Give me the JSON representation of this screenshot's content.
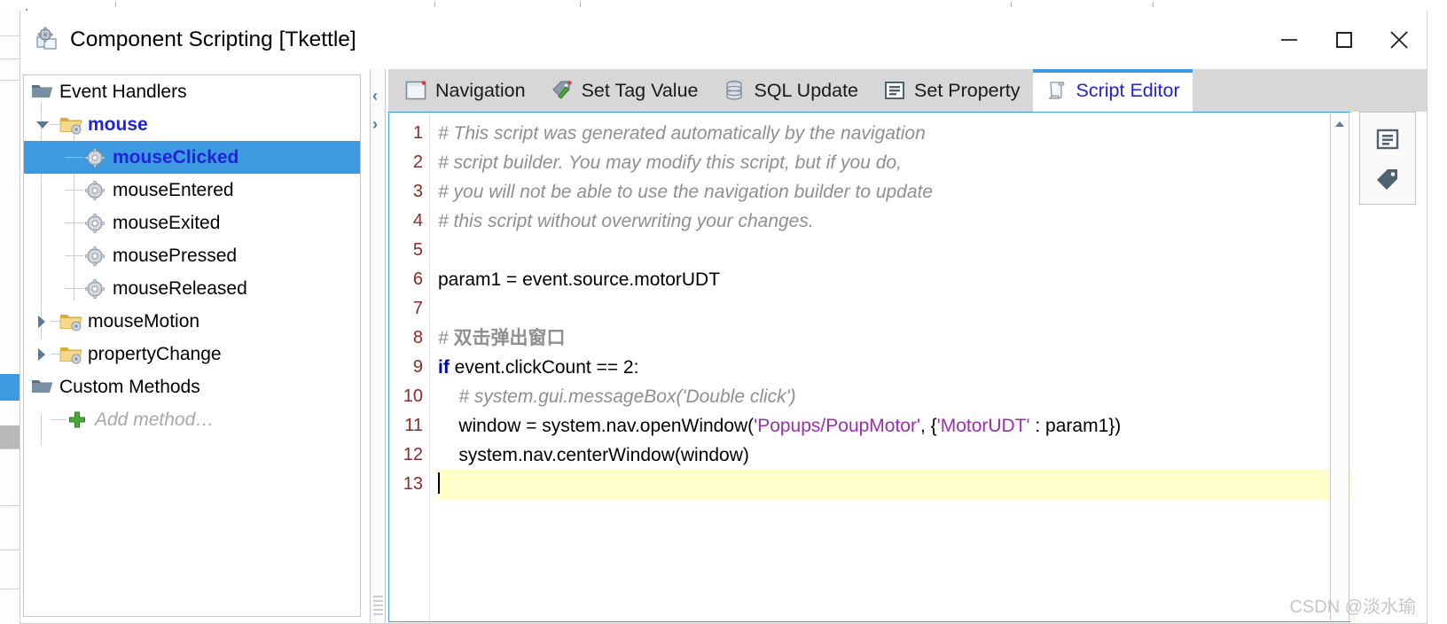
{
  "window": {
    "title": "Component Scripting [Tkettle]",
    "icon": "component-scripting-icon",
    "buttons": {
      "minimize": "minimize-button",
      "maximize": "maximize-button",
      "close": "close-button"
    }
  },
  "tree": {
    "items": [
      {
        "label": "Event Handlers",
        "icon": "folder-dark-icon",
        "indent": 0,
        "twisty": "none",
        "state": "normal",
        "connector": "none"
      },
      {
        "label": "mouse",
        "icon": "folder-gear-icon",
        "indent": 1,
        "twisty": "down",
        "state": "bold",
        "connector": "dash"
      },
      {
        "label": "mouseClicked",
        "icon": "gear-icon",
        "indent": 2,
        "twisty": "none",
        "state": "selected",
        "connector": "tee"
      },
      {
        "label": "mouseEntered",
        "icon": "gear-icon",
        "indent": 2,
        "twisty": "none",
        "state": "normal",
        "connector": "tee"
      },
      {
        "label": "mouseExited",
        "icon": "gear-icon",
        "indent": 2,
        "twisty": "none",
        "state": "normal",
        "connector": "tee"
      },
      {
        "label": "mousePressed",
        "icon": "gear-icon",
        "indent": 2,
        "twisty": "none",
        "state": "normal",
        "connector": "tee"
      },
      {
        "label": "mouseReleased",
        "icon": "gear-icon",
        "indent": 2,
        "twisty": "none",
        "state": "normal",
        "connector": "elbow"
      },
      {
        "label": "mouseMotion",
        "icon": "folder-gear-icon",
        "indent": 1,
        "twisty": "right",
        "state": "normal",
        "connector": "dash"
      },
      {
        "label": "propertyChange",
        "icon": "folder-gear-icon",
        "indent": 1,
        "twisty": "right",
        "state": "normal",
        "connector": "dash"
      },
      {
        "label": "Custom Methods",
        "icon": "folder-dark-icon",
        "indent": 0,
        "twisty": "none",
        "state": "normal",
        "connector": "none"
      },
      {
        "label": "Add method…",
        "icon": "plus-icon",
        "indent": 1,
        "twisty": "none",
        "state": "ghost",
        "connector": "elbow"
      }
    ]
  },
  "splitter": {
    "collapse_left": "‹",
    "collapse_right": "›"
  },
  "tabs": [
    {
      "label": "Navigation",
      "icon": "window-icon",
      "active": false
    },
    {
      "label": "Set Tag Value",
      "icon": "tag-pencil-icon",
      "active": false
    },
    {
      "label": "SQL Update",
      "icon": "database-icon",
      "active": false
    },
    {
      "label": "Set Property",
      "icon": "property-icon",
      "active": false
    },
    {
      "label": "Script Editor",
      "icon": "script-icon",
      "active": true
    }
  ],
  "editor": {
    "lines": [
      {
        "n": "1",
        "highlight": false,
        "cursor": false,
        "tokens": [
          {
            "t": "comment",
            "s": "# This script was generated automatically by the navigation"
          }
        ]
      },
      {
        "n": "2",
        "highlight": false,
        "cursor": false,
        "tokens": [
          {
            "t": "comment",
            "s": "# script builder. You may modify this script, but if you do,"
          }
        ]
      },
      {
        "n": "3",
        "highlight": false,
        "cursor": false,
        "tokens": [
          {
            "t": "comment",
            "s": "# you will not be able to use the navigation builder to update"
          }
        ]
      },
      {
        "n": "4",
        "highlight": false,
        "cursor": false,
        "tokens": [
          {
            "t": "comment",
            "s": "# this script without overwriting your changes."
          }
        ]
      },
      {
        "n": "5",
        "highlight": false,
        "cursor": false,
        "tokens": []
      },
      {
        "n": "6",
        "highlight": false,
        "cursor": false,
        "tokens": [
          {
            "t": "plain",
            "s": "param1 = event.source.motorUDT"
          }
        ]
      },
      {
        "n": "7",
        "highlight": false,
        "cursor": false,
        "tokens": []
      },
      {
        "n": "8",
        "highlight": false,
        "cursor": false,
        "tokens": [
          {
            "t": "comment",
            "s": "# "
          },
          {
            "t": "comment-cjk",
            "s": "双击弹出窗口"
          }
        ]
      },
      {
        "n": "9",
        "highlight": false,
        "cursor": false,
        "tokens": [
          {
            "t": "kw",
            "s": "if"
          },
          {
            "t": "plain",
            "s": " event.clickCount == 2:"
          }
        ]
      },
      {
        "n": "10",
        "highlight": false,
        "cursor": false,
        "tokens": [
          {
            "t": "comment",
            "s": "    # system.gui.messageBox('Double click')"
          }
        ]
      },
      {
        "n": "11",
        "highlight": false,
        "cursor": false,
        "tokens": [
          {
            "t": "plain",
            "s": "    window = system.nav.openWindow("
          },
          {
            "t": "str",
            "s": "'Popups/PoupMotor'"
          },
          {
            "t": "plain",
            "s": ", {"
          },
          {
            "t": "str",
            "s": "'MotorUDT'"
          },
          {
            "t": "plain",
            "s": " : param1})"
          }
        ]
      },
      {
        "n": "12",
        "highlight": false,
        "cursor": false,
        "tokens": [
          {
            "t": "plain",
            "s": "    system.nav.centerWindow(window)"
          }
        ]
      },
      {
        "n": "13",
        "highlight": true,
        "cursor": true,
        "tokens": []
      }
    ],
    "scrollbar": {
      "up_arrow": "scroll-up-arrow"
    }
  },
  "toolstrip": {
    "buttons": [
      {
        "icon": "property-list-icon",
        "name": "properties-button"
      },
      {
        "icon": "tag-icon",
        "name": "tag-browser-button"
      }
    ]
  },
  "watermark": "CSDN @淡水瑜",
  "colors": {
    "selection": "#3d9ae0",
    "tab_active_accent": "#3d9ae0",
    "link_blue": "#2222dd",
    "line_number": "#8b2a2a",
    "comment_gray": "#8f8f8f",
    "string_purple": "#9b2fae",
    "keyword_blue": "#00009f",
    "current_line": "#ffffcc"
  }
}
